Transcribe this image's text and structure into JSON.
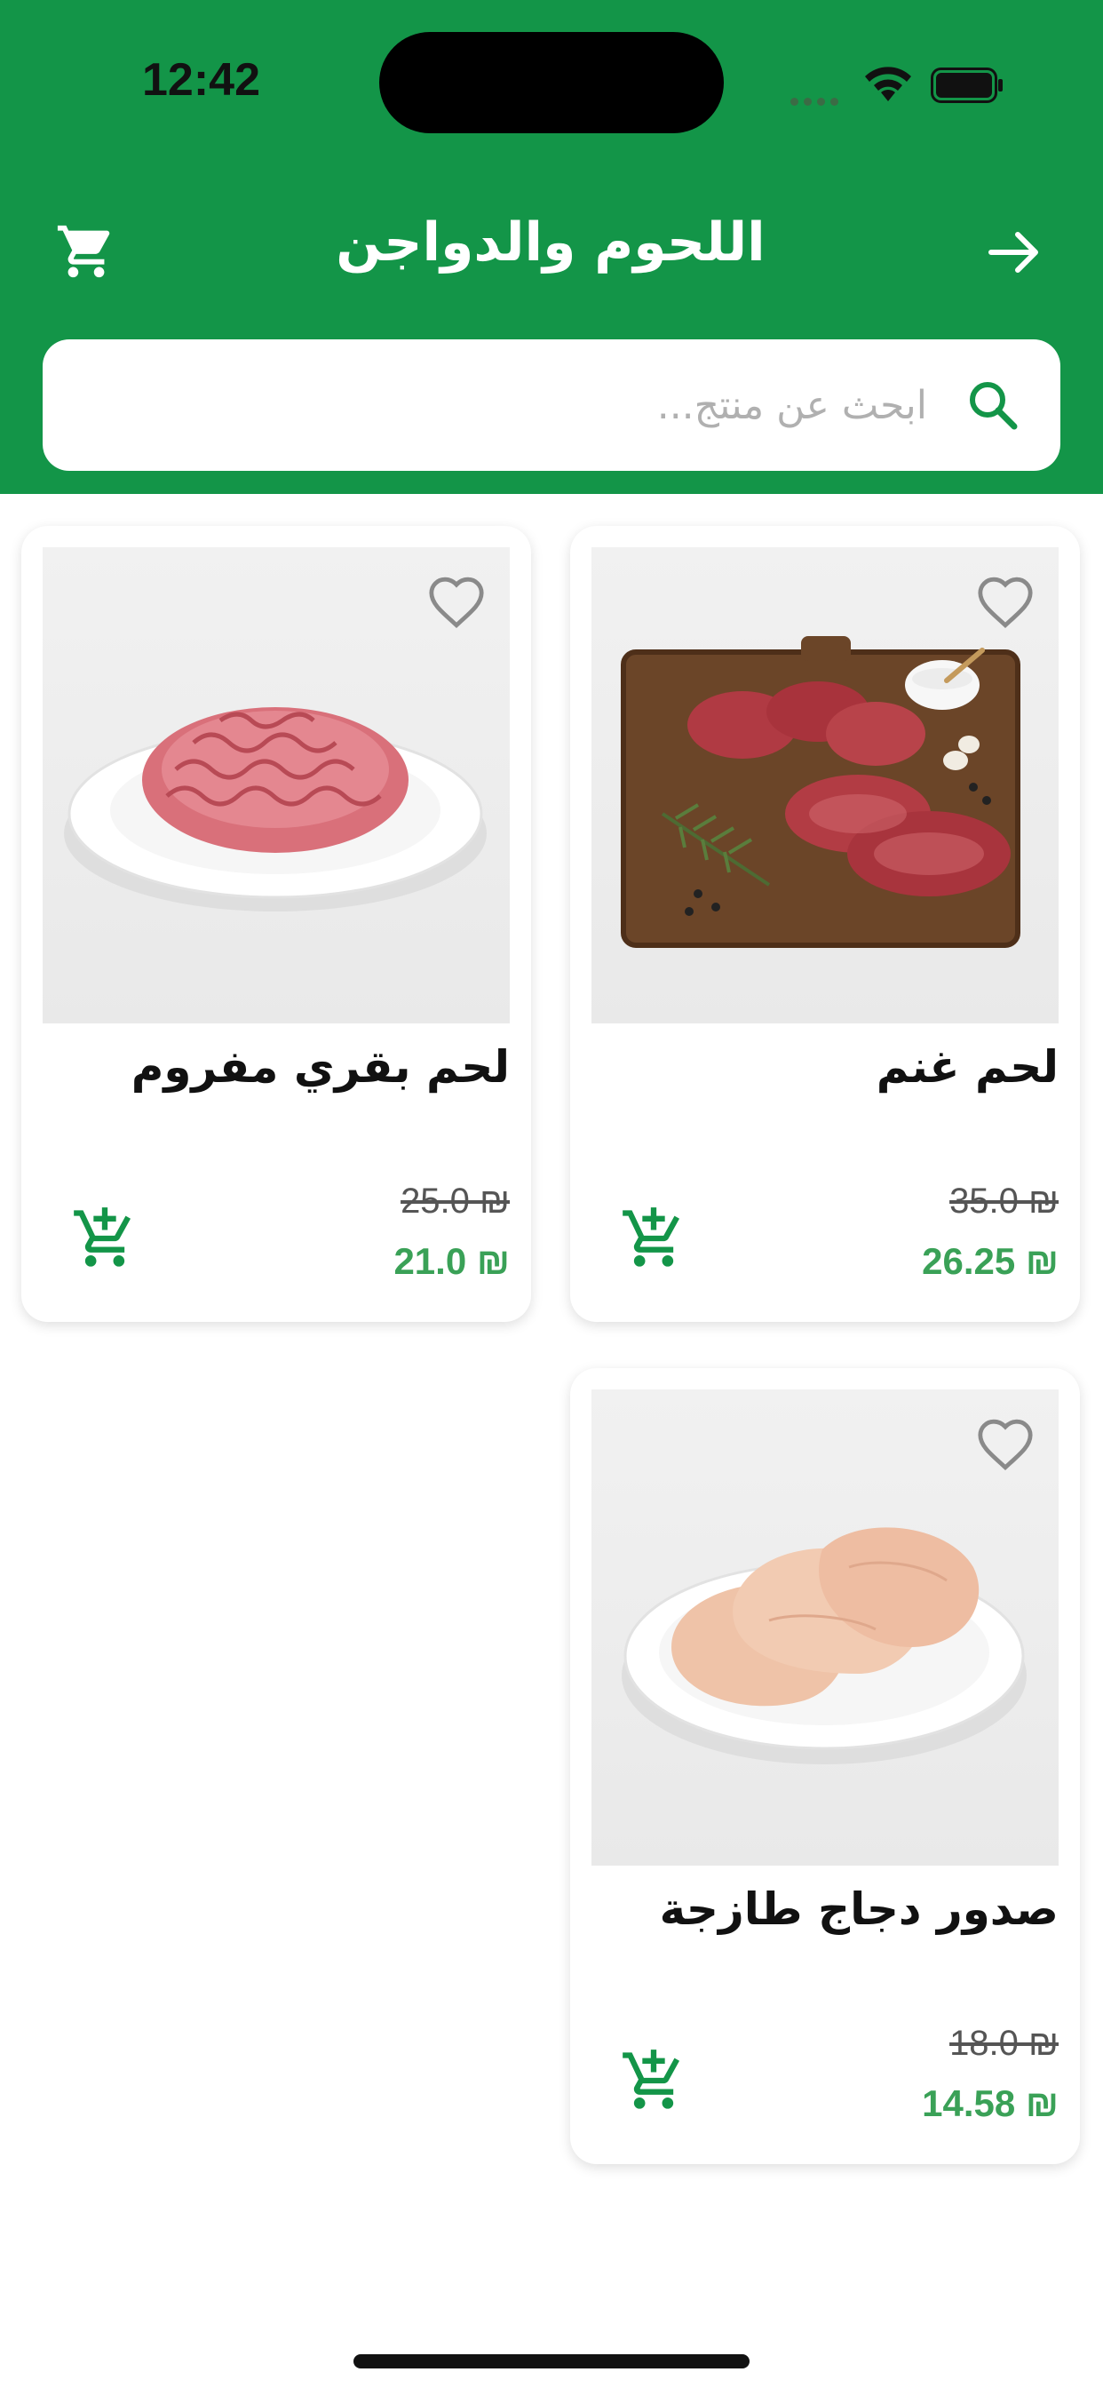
{
  "status_bar": {
    "time": "12:42"
  },
  "header": {
    "title": "اللحوم والدواجن",
    "background_color": "#139548",
    "cart_icon": "cart-icon",
    "back_icon": "arrow-right-icon"
  },
  "search": {
    "placeholder": "ابحث عن منتج..."
  },
  "products": [
    {
      "name": "لحم غنم",
      "old_price": "35.0 ₪",
      "price": "26.25 ₪",
      "image": "lamb-chops-on-board"
    },
    {
      "name": "لحم بقري مفروم",
      "old_price": "25.0 ₪",
      "price": "21.0 ₪",
      "image": "minced-beef-on-plate"
    },
    {
      "name": "صدور دجاج طازجة",
      "old_price": "18.0 ₪",
      "price": "14.58 ₪",
      "image": "chicken-breasts-on-plate"
    }
  ],
  "colors": {
    "accent": "#139548",
    "price": "#3aa157"
  }
}
